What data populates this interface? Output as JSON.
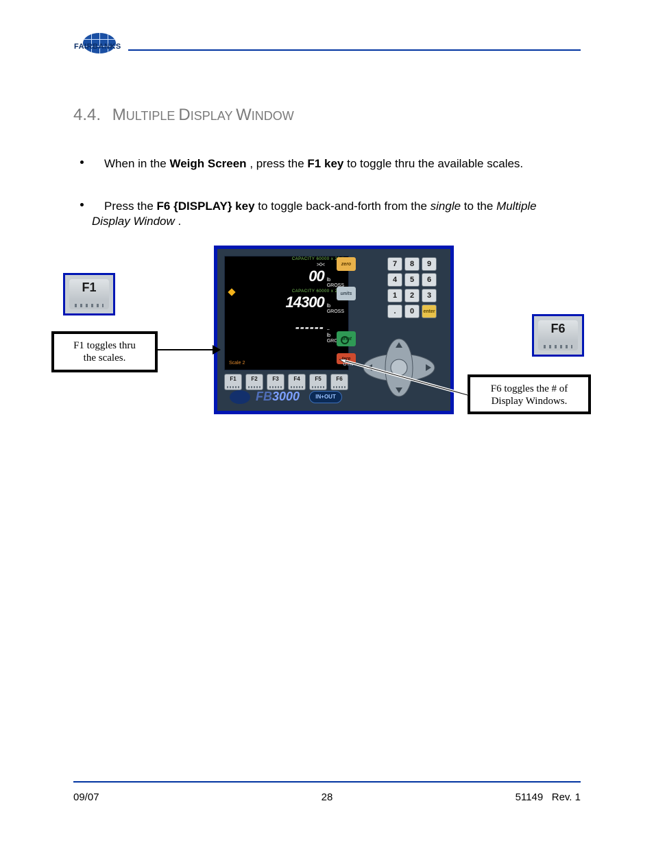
{
  "header": {
    "brand": "FAIRBANKS"
  },
  "section": {
    "number": "4.4.",
    "title_a": "M",
    "title_b": "ULTIPLE ",
    "title_c": "D",
    "title_d": "ISPLAY ",
    "title_e": "W",
    "title_f": "INDOW"
  },
  "bullets": {
    "b1": {
      "pre": "When in the ",
      "bold1": "Weigh Screen",
      "mid": ", press the ",
      "bold2": "F1 key",
      "post": " to toggle thru the available scales."
    },
    "b2": {
      "pre": "Press the ",
      "bold1": "F6 {DISPLAY} key",
      "mid": " to toggle back-and-forth from the ",
      "ital1": "single",
      "to": " to the ",
      "ital2": "Multiple Display Window",
      "end": "."
    }
  },
  "device": {
    "cap": "CAPACITY 60000 x 20 lb",
    "zero_sym": ">0<",
    "unit_lb": "lb",
    "unit_gross": "GROSS",
    "line1": "00",
    "line2": "14300",
    "dashes": "------",
    "tilde": "~",
    "scale_label": "Scale 2",
    "btn_zero": "zero",
    "btn_units": "units",
    "btn_print": "print",
    "btn_tare": "tare",
    "gtn": "GTN",
    "keypad": [
      "7",
      "8",
      "9",
      "4",
      "5",
      "6",
      "1",
      "2",
      "3",
      ".",
      "0",
      "enter"
    ],
    "fkeys": [
      "F1",
      "F2",
      "F3",
      "F4",
      "F5",
      "F6"
    ],
    "brand_fb": "FB",
    "brand_num": "3000",
    "pill": "IN+OUT"
  },
  "sidekeys": {
    "left": "F1",
    "right": "F6"
  },
  "callouts": {
    "left_l1": "F1 toggles thru",
    "left_l2": "the scales.",
    "right_l1": "F6 toggles the # of",
    "right_l2": "Display Windows."
  },
  "footer": {
    "date": "09/07",
    "page": "28",
    "doc": "51149",
    "rev": "Rev. 1"
  }
}
